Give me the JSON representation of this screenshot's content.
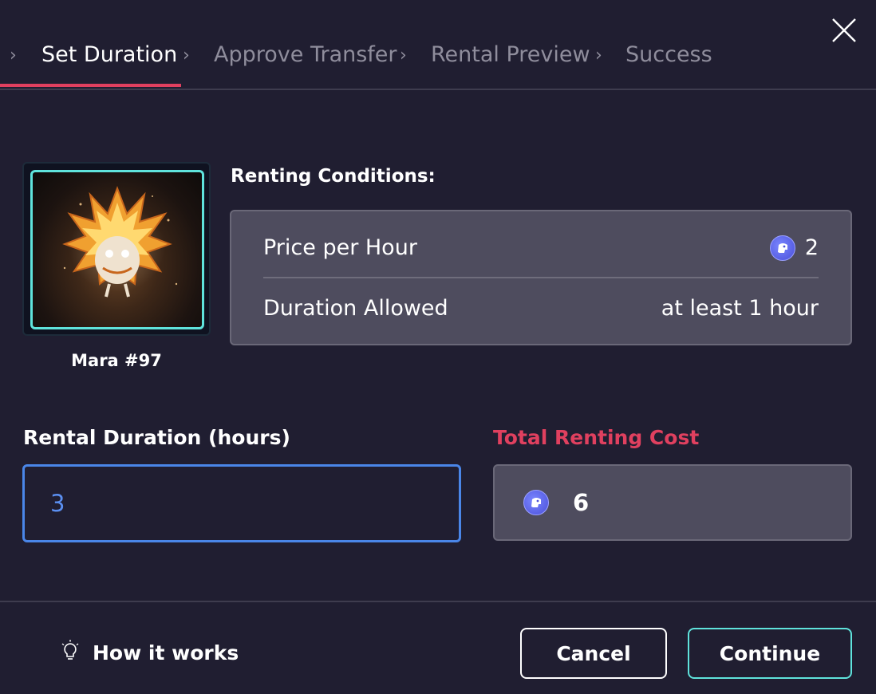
{
  "stepper": {
    "steps": [
      {
        "label": "Set Duration",
        "active": true
      },
      {
        "label": "Approve Transfer",
        "active": false
      },
      {
        "label": "Rental Preview",
        "active": false
      },
      {
        "label": "Success",
        "active": false
      }
    ],
    "accent_color": "#e0405f"
  },
  "nft": {
    "name": "Mara #97",
    "frame_color": "#5fe3dc"
  },
  "conditions": {
    "title": "Renting Conditions:",
    "price_label": "Price per Hour",
    "price_value": "2",
    "duration_label": "Duration Allowed",
    "duration_value": "at least 1 hour",
    "currency_icon": "ape-coin-icon"
  },
  "rental": {
    "duration_label": "Rental Duration (hours)",
    "duration_value": "3",
    "total_label": "Total Renting Cost",
    "total_value": "6",
    "total_label_color": "#e0405f",
    "input_focus_color": "#4a86e8"
  },
  "footer": {
    "how_label": "How it works",
    "cancel_label": "Cancel",
    "continue_label": "Continue",
    "continue_border_color": "#5fe3dc"
  }
}
